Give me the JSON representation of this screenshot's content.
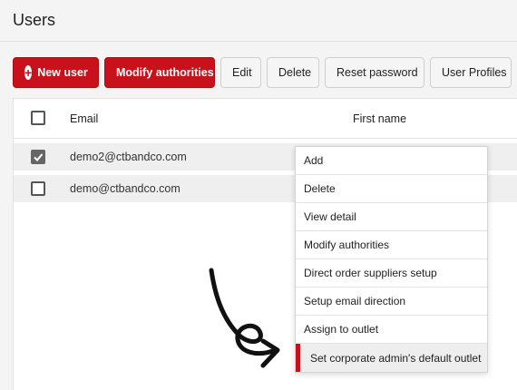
{
  "header": {
    "title": "Users"
  },
  "toolbar": {
    "new_user": "New user",
    "modify_authorities": "Modify authorities",
    "edit": "Edit",
    "delete": "Delete",
    "reset_password": "Reset password",
    "user_profiles": "User Profiles"
  },
  "table": {
    "columns": {
      "email": "Email",
      "first_name": "First name"
    },
    "rows": [
      {
        "email": "demo2@ctbandco.com",
        "checked": true
      },
      {
        "email": "demo@ctbandco.com",
        "checked": false
      }
    ]
  },
  "context_menu": {
    "items": [
      "Add",
      "Delete",
      "View detail",
      "Modify authorities",
      "Direct order suppliers setup",
      "Setup email direction",
      "Assign to outlet",
      "Set corporate admin's default outlet"
    ],
    "highlighted_index": 7
  },
  "colors": {
    "brand": "#c8111a",
    "row_bg": "#efefef"
  }
}
